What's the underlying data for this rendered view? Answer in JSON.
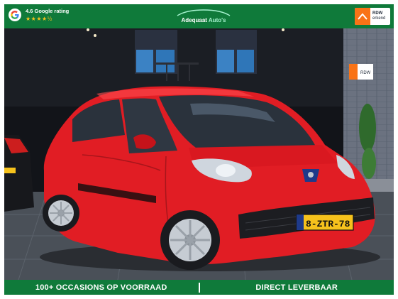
{
  "header": {
    "google_rating_label": "4.6 Google rating",
    "stars_text": "★★★★½",
    "brand_name_part1": "Adequaat",
    "brand_name_part2": "Auto's",
    "rdw_text_line1": "RDW",
    "rdw_text_line2": "erkend"
  },
  "photo": {
    "license_plate": "8-ZTR-78",
    "sign_text_line1": "RDW"
  },
  "footer": {
    "left_text": "100+ OCCASIONS OP VOORRAAD",
    "right_text": "DIRECT LEVERBAAR"
  },
  "colors": {
    "bar_green": "#0f7a3a",
    "car_red": "#e11d24",
    "plate_yellow": "#f6c21c",
    "rdw_orange": "#f97316"
  }
}
